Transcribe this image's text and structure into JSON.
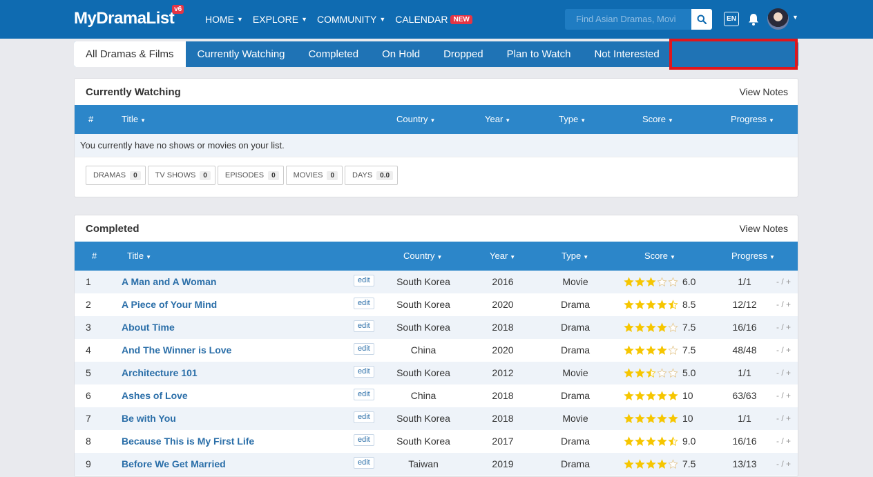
{
  "nav": {
    "logo": "MyDramaList",
    "logo_badge": "v6",
    "items": [
      {
        "label": "HOME",
        "caret": true
      },
      {
        "label": "EXPLORE",
        "caret": true
      },
      {
        "label": "COMMUNITY",
        "caret": true
      },
      {
        "label": "CALENDAR",
        "caret": false
      }
    ],
    "calendar_badge": "NEW",
    "search_placeholder": "Find Asian Dramas, Movi",
    "language": "EN"
  },
  "tabs": [
    "All Dramas & Films",
    "Currently Watching",
    "Completed",
    "On Hold",
    "Dropped",
    "Plan to Watch",
    "Not Interested"
  ],
  "columns": {
    "num": "#",
    "title": "Title",
    "country": "Country",
    "year": "Year",
    "type": "Type",
    "score": "Score",
    "progress": "Progress"
  },
  "currently_watching": {
    "title": "Currently Watching",
    "view_notes": "View Notes",
    "empty": "You currently have no shows or movies on your list.",
    "stats": [
      {
        "label": "DRAMAS",
        "value": "0"
      },
      {
        "label": "TV SHOWS",
        "value": "0"
      },
      {
        "label": "EPISODES",
        "value": "0"
      },
      {
        "label": "MOVIES",
        "value": "0"
      },
      {
        "label": "DAYS",
        "value": "0.0"
      }
    ]
  },
  "completed": {
    "title": "Completed",
    "view_notes": "View Notes",
    "edit_label": "edit",
    "adjust_label": "- / +",
    "rows": [
      {
        "num": "1",
        "title": "A Man and A Woman",
        "country": "South Korea",
        "year": "2016",
        "type": "Movie",
        "score": "6.0",
        "stars": 3,
        "progress": "1/1"
      },
      {
        "num": "2",
        "title": "A Piece of Your Mind",
        "country": "South Korea",
        "year": "2020",
        "type": "Drama",
        "score": "8.5",
        "stars": 4.5,
        "progress": "12/12"
      },
      {
        "num": "3",
        "title": "About Time",
        "country": "South Korea",
        "year": "2018",
        "type": "Drama",
        "score": "7.5",
        "stars": 4,
        "progress": "16/16"
      },
      {
        "num": "4",
        "title": "And The Winner is Love",
        "country": "China",
        "year": "2020",
        "type": "Drama",
        "score": "7.5",
        "stars": 4,
        "progress": "48/48"
      },
      {
        "num": "5",
        "title": "Architecture 101",
        "country": "South Korea",
        "year": "2012",
        "type": "Movie",
        "score": "5.0",
        "stars": 2.5,
        "progress": "1/1"
      },
      {
        "num": "6",
        "title": "Ashes of Love",
        "country": "China",
        "year": "2018",
        "type": "Drama",
        "score": "10",
        "stars": 5,
        "progress": "63/63"
      },
      {
        "num": "7",
        "title": "Be with You",
        "country": "South Korea",
        "year": "2018",
        "type": "Movie",
        "score": "10",
        "stars": 5,
        "progress": "1/1"
      },
      {
        "num": "8",
        "title": "Because This is My First Life",
        "country": "South Korea",
        "year": "2017",
        "type": "Drama",
        "score": "9.0",
        "stars": 4.5,
        "progress": "16/16"
      },
      {
        "num": "9",
        "title": "Before We Get Married",
        "country": "Taiwan",
        "year": "2019",
        "type": "Drama",
        "score": "7.5",
        "stars": 4,
        "progress": "13/13"
      }
    ]
  },
  "colors": {
    "nav_bg": "#0f6bb1",
    "tab_bg": "#1f73b5",
    "table_header": "#2c86c9",
    "link": "#2a6ea8",
    "star": "#f6c600",
    "highlight": "#e0161b",
    "badge": "#e53545"
  }
}
